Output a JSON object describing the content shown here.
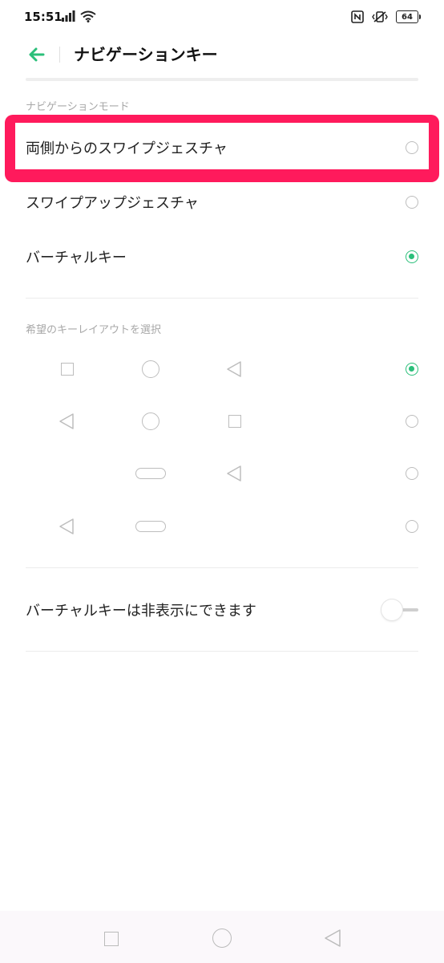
{
  "status_bar": {
    "time": "15:51",
    "icons_left": [
      "signal-icon",
      "wifi-icon"
    ],
    "icons_right": [
      "nfc-icon",
      "vibrate-icon",
      "battery-icon"
    ],
    "battery": "64"
  },
  "header": {
    "title": "ナビゲーションキー"
  },
  "navigation_mode": {
    "label": "ナビゲーションモード",
    "options": [
      {
        "label": "両側からのスワイプジェスチャ",
        "selected": false
      },
      {
        "label": "スワイプアップジェスチャ",
        "selected": false
      },
      {
        "label": "バーチャルキー",
        "selected": true
      }
    ]
  },
  "key_layout": {
    "label": "希望のキーレイアウトを選択",
    "layouts": [
      {
        "keys": [
          "square-icon",
          "circle-icon",
          "back-triangle-icon"
        ],
        "selected": true
      },
      {
        "keys": [
          "back-triangle-icon",
          "circle-icon",
          "square-icon"
        ],
        "selected": false
      },
      {
        "keys": [
          "pill-icon",
          "back-triangle-icon"
        ],
        "selected": false
      },
      {
        "keys": [
          "back-triangle-icon",
          "pill-icon"
        ],
        "selected": false
      }
    ]
  },
  "hide_keys": {
    "label": "バーチャルキーは非表示にできます",
    "enabled": false
  },
  "colors": {
    "accent": "#2bbf7a",
    "highlight": "#ff1a5c"
  }
}
